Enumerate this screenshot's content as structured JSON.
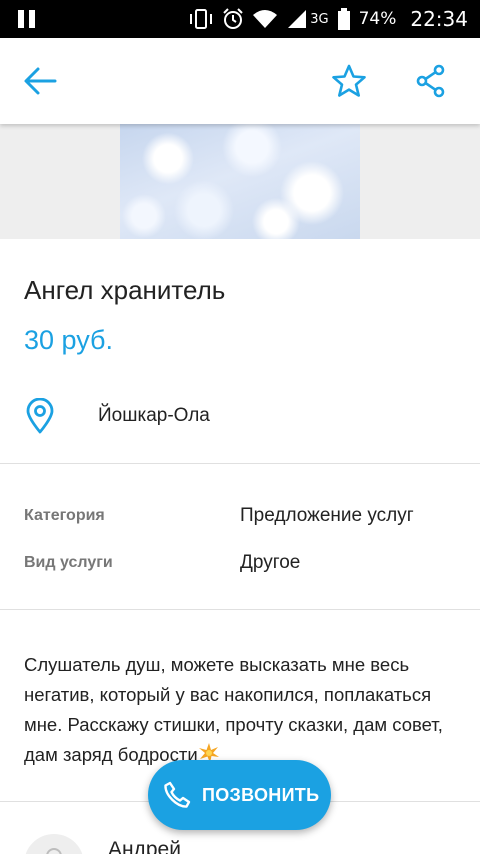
{
  "status_bar": {
    "network": "3G",
    "battery": "74%",
    "time": "22:34"
  },
  "toolbar": {
    "back_icon": "arrow-left-icon",
    "favorite_icon": "star-outline-icon",
    "share_icon": "share-icon"
  },
  "listing": {
    "title": "Ангел хранитель",
    "price": "30 руб.",
    "location": "Йошкар-Ола",
    "properties": [
      {
        "label": "Категория",
        "value": "Предложение услуг"
      },
      {
        "label": "Вид услуги",
        "value": "Другое"
      }
    ],
    "description": "Слушатель душ, можете высказать мне весь негатив, который у вас накопился, поплакаться мне. Расскажу стишки, прочту сказки, дам совет, дам заряд бодрости"
  },
  "seller": {
    "name": "Андрей"
  },
  "call_button": {
    "label": "ПОЗВОНИТЬ"
  },
  "colors": {
    "accent": "#1ba1e2",
    "status_bar": "#000000",
    "divider": "#e0e0e0"
  }
}
